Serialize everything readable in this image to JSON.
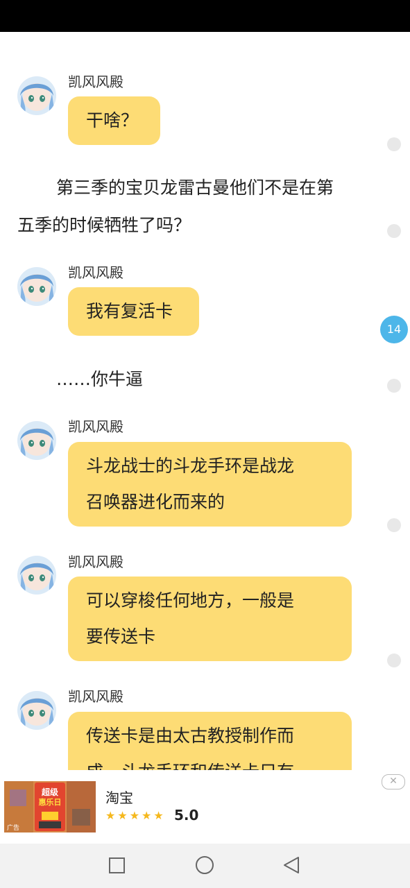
{
  "messages": [
    {
      "type": "bubble",
      "sender": "凯风风殿",
      "lines": [
        "干啥？"
      ]
    },
    {
      "type": "narration",
      "lines": [
        "第三季的宝贝龙雷古曼他们不是在第",
        "五季的时候牺牲了吗？"
      ]
    },
    {
      "type": "bubble",
      "sender": "凯风风殿",
      "lines": [
        "我有复活卡"
      ]
    },
    {
      "type": "narration",
      "lines": [
        "……你牛逼"
      ]
    },
    {
      "type": "bubble",
      "sender": "凯风风殿",
      "lines": [
        "斗龙战士的斗龙手环是战龙",
        "召唤器进化而来的"
      ]
    },
    {
      "type": "bubble",
      "sender": "凯风风殿",
      "lines": [
        "可以穿梭任何地方，一般是",
        "要传送卡"
      ]
    },
    {
      "type": "bubble",
      "sender": "凯风风殿",
      "lines": [
        "传送卡是由太古教授制作而",
        "成，斗龙手环和传送卡只有"
      ]
    }
  ],
  "comment_count": "14",
  "ad": {
    "title": "淘宝",
    "stars": "★★★★★",
    "rating": "5.0",
    "close": "✕",
    "image_text": [
      "超级",
      "惠乐日"
    ],
    "badge": "广告"
  },
  "navbar": {
    "icons": [
      "recent-apps-icon",
      "home-icon",
      "back-icon"
    ]
  },
  "colors": {
    "bubble": "#fddc75",
    "comment_badge": "#4db6e9",
    "status_bar": "#000000"
  }
}
